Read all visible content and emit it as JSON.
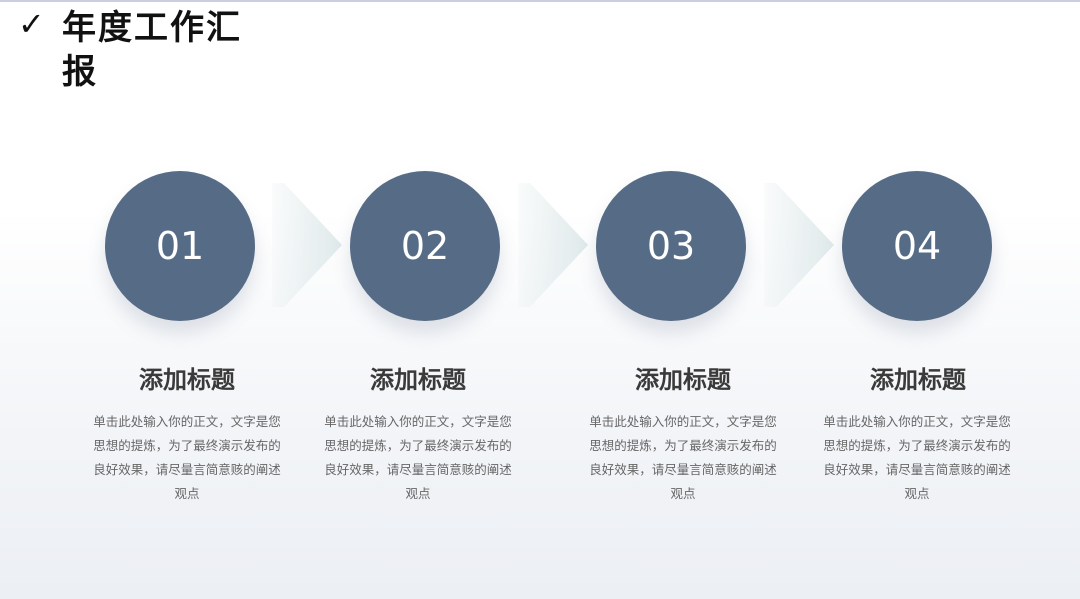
{
  "header": {
    "check_icon": "✓",
    "title": "年度工作汇报"
  },
  "colors": {
    "circle": "#566b86",
    "arrow": "#dfe9ea",
    "title_text": "#3a3a3a",
    "body_text": "#666666"
  },
  "steps": [
    {
      "number": "01",
      "title": "添加标题",
      "body": "单击此处输入你的正文，文字是您思想的提炼，为了最终演示发布的良好效果，请尽量言简意赅的阐述观点"
    },
    {
      "number": "02",
      "title": "添加标题",
      "body": "单击此处输入你的正文，文字是您思想的提炼，为了最终演示发布的良好效果，请尽量言简意赅的阐述观点"
    },
    {
      "number": "03",
      "title": "添加标题",
      "body": "单击此处输入你的正文，文字是您思想的提炼，为了最终演示发布的良好效果，请尽量言简意赅的阐述观点"
    },
    {
      "number": "04",
      "title": "添加标题",
      "body": "单击此处输入你的正文，文字是您思想的提炼，为了最终演示发布的良好效果，请尽量言简意赅的阐述观点"
    }
  ]
}
